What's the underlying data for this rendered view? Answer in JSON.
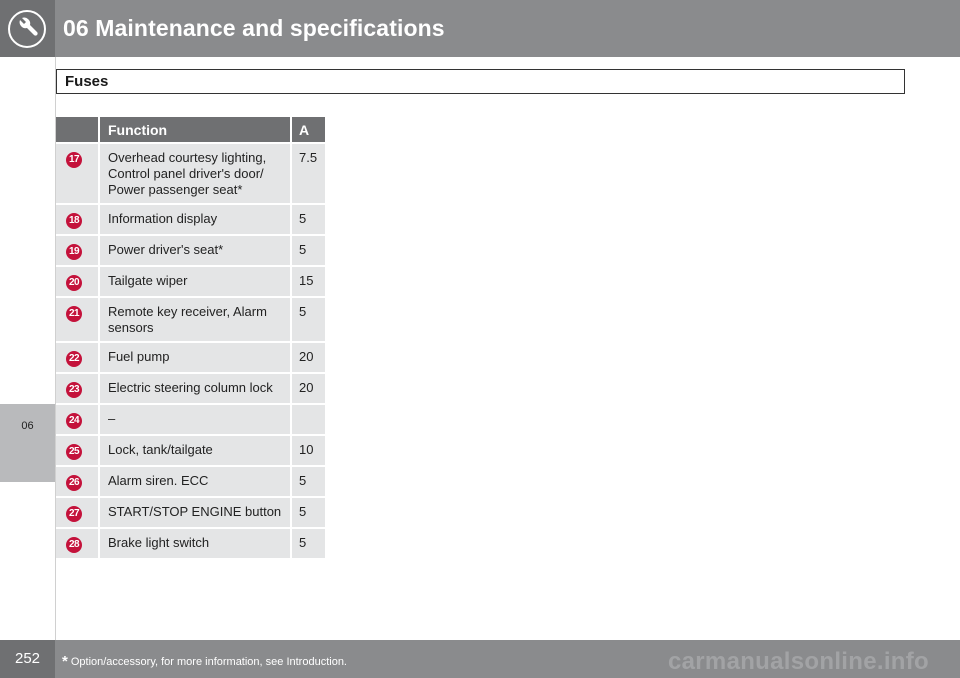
{
  "header": {
    "chapter_title": "06 Maintenance and specifications"
  },
  "section": {
    "title": "Fuses"
  },
  "side_tab": {
    "label": "06"
  },
  "table": {
    "columns": [
      "",
      "Function",
      "A"
    ],
    "rows": [
      {
        "num": "17",
        "function": "Overhead courtesy lighting, Control panel driver's door/ Power passenger seat*",
        "amp": "7.5"
      },
      {
        "num": "18",
        "function": "Information display",
        "amp": "5"
      },
      {
        "num": "19",
        "function": "Power driver's seat*",
        "amp": "5"
      },
      {
        "num": "20",
        "function": "Tailgate wiper",
        "amp": "15"
      },
      {
        "num": "21",
        "function": "Remote key receiver, Alarm sensors",
        "amp": "5"
      },
      {
        "num": "22",
        "function": "Fuel pump",
        "amp": "20"
      },
      {
        "num": "23",
        "function": "Electric steering column lock",
        "amp": "20"
      },
      {
        "num": "24",
        "function": "–",
        "amp": ""
      },
      {
        "num": "25",
        "function": "Lock, tank/tailgate",
        "amp": "10"
      },
      {
        "num": "26",
        "function": "Alarm siren. ECC",
        "amp": "5"
      },
      {
        "num": "27",
        "function": "START/STOP ENGINE button",
        "amp": "5"
      },
      {
        "num": "28",
        "function": "Brake light switch",
        "amp": "5"
      }
    ]
  },
  "footer": {
    "page_number": "252",
    "footnote_mark": "*",
    "footnote_text": "Option/accessory, for more information, see Introduction."
  },
  "watermark": "carmanualsonline.info",
  "colors": {
    "header_bg": "#8a8b8d",
    "badge": "#c4123b",
    "row_bg": "#e4e5e6"
  }
}
